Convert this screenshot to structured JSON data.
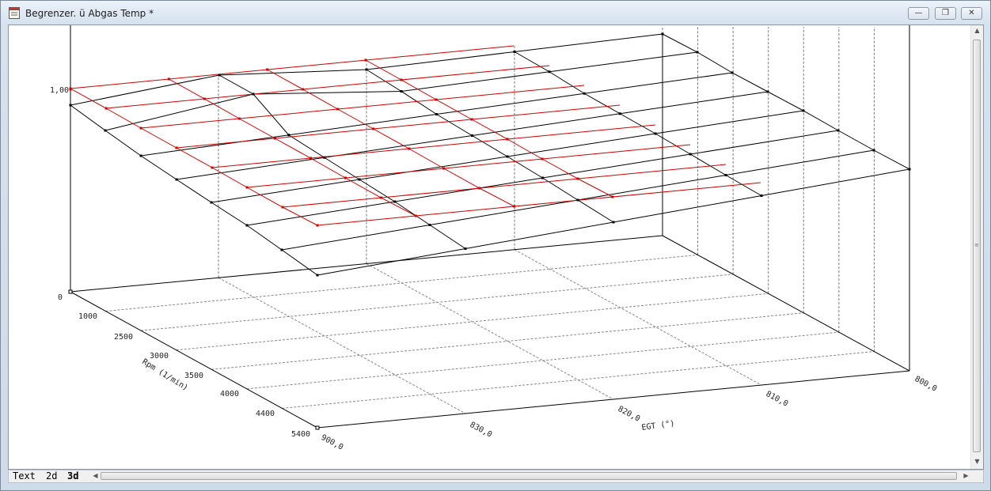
{
  "window": {
    "title": "Begrenzer. ü Abgas Temp *",
    "minimize_icon": "minimize-icon",
    "restore_icon": "restore-icon",
    "close_icon": "close-icon"
  },
  "tabs": [
    {
      "label": "Text"
    },
    {
      "label": "2d"
    },
    {
      "label": "3d",
      "active": true
    }
  ],
  "plot": {
    "z_tick_top": "1,00",
    "z_tick_bottom": "0",
    "rpm_axis_label": "Rpm (1/min)",
    "rpm_ticks": [
      "1000",
      "2500",
      "3000",
      "3500",
      "4000",
      "4400",
      "5400"
    ],
    "egt_axis_label": "EGT (°)",
    "egt_ticks": [
      "900,0",
      "830,0",
      "820,0",
      "810,0",
      "800,0"
    ],
    "wire_color": "#000000",
    "highlight_color": "#cc0000"
  },
  "chart_data": {
    "type": "surface",
    "x": {
      "name": "EGT (°)",
      "values": [
        900.0,
        830.0,
        820.0,
        810.0,
        800.0
      ]
    },
    "y": {
      "name": "Rpm (1/min)",
      "values": [
        0,
        1000,
        2500,
        3000,
        3500,
        4000,
        4400,
        5400
      ]
    },
    "zlim": [
      0,
      1.0
    ]
  }
}
